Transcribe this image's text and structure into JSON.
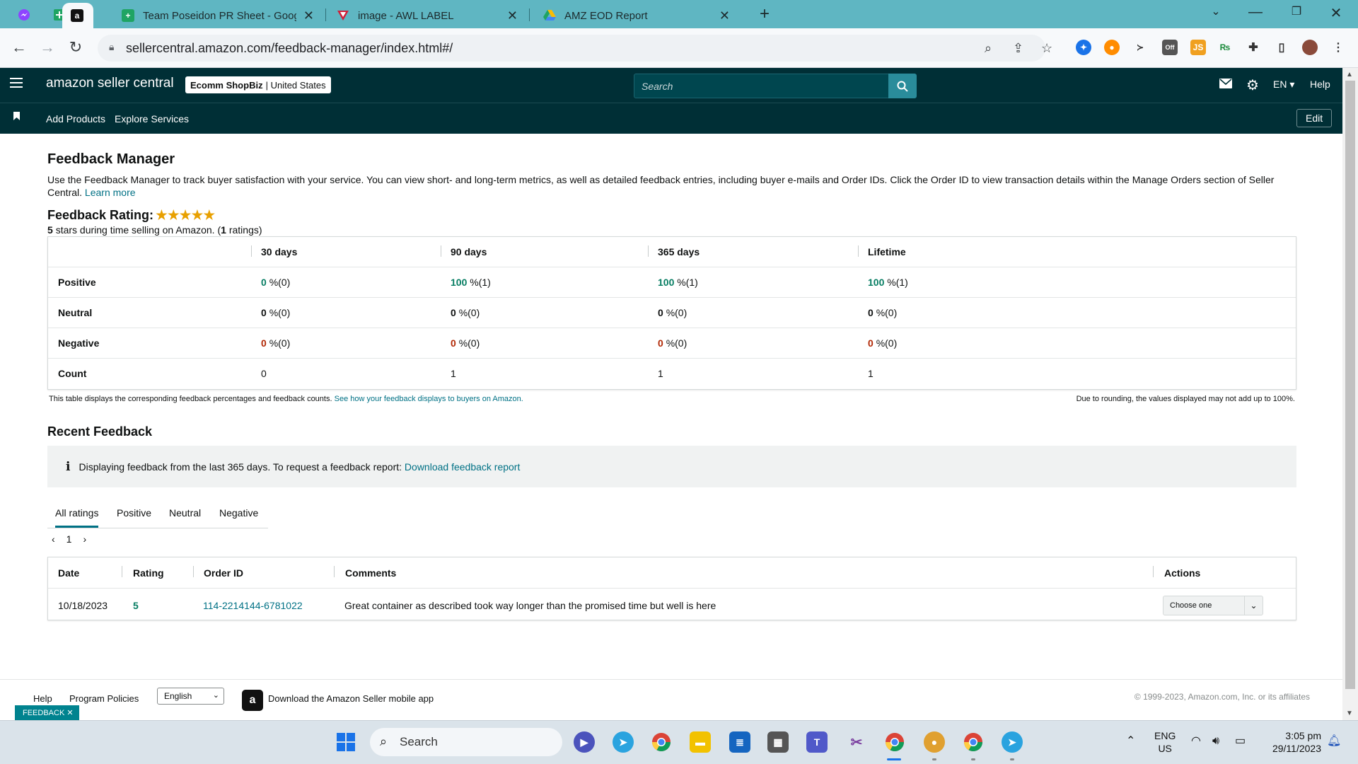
{
  "browser": {
    "tabs": [
      {
        "title": "Team Poseidon PR Sheet - Goog",
        "icon": "google-sheets-icon"
      },
      {
        "title": "image - AWL LABEL",
        "icon": "awl-label-icon"
      },
      {
        "title": "AMZ EOD Report",
        "icon": "drive-icon"
      }
    ],
    "url": "sellercentral.amazon.com/feedback-manager/index.html#/"
  },
  "header": {
    "logo": "amazon seller central",
    "store_name": "Ecomm ShopBiz",
    "store_region": "United States",
    "search_placeholder": "Search",
    "language": "EN",
    "help": "Help"
  },
  "subnav": {
    "links": [
      "Add Products",
      "Explore Services"
    ],
    "edit": "Edit"
  },
  "page": {
    "title": "Feedback Manager",
    "description": "Use the Feedback Manager to track buyer satisfaction with your service. You can view short- and long-term metrics, as well as detailed feedback entries, including buyer e-mails and Order IDs. Click the Order ID to view transaction details within the Manage Orders section of Seller Central.",
    "learn_more": "Learn more",
    "rating_title": "Feedback Rating:",
    "rating_stars": 5,
    "rating_value": "5",
    "rating_text_mid": "stars during time selling on Amazon. (",
    "rating_count": "1",
    "rating_text_end": "ratings)"
  },
  "metrics": {
    "columns": [
      "30 days",
      "90 days",
      "365 days",
      "Lifetime"
    ],
    "rows": [
      {
        "label": "Positive",
        "cells": [
          {
            "v": "0",
            "s": "%(0)"
          },
          {
            "v": "100",
            "s": "%(1)"
          },
          {
            "v": "100",
            "s": "%(1)"
          },
          {
            "v": "100",
            "s": "%(1)"
          }
        ]
      },
      {
        "label": "Neutral",
        "cells": [
          {
            "v": "0",
            "s": "%(0)"
          },
          {
            "v": "0",
            "s": "%(0)"
          },
          {
            "v": "0",
            "s": "%(0)"
          },
          {
            "v": "0",
            "s": "%(0)"
          }
        ]
      },
      {
        "label": "Negative",
        "cells": [
          {
            "v": "0",
            "s": "%(0)"
          },
          {
            "v": "0",
            "s": "%(0)"
          },
          {
            "v": "0",
            "s": "%(0)"
          },
          {
            "v": "0",
            "s": "%(0)"
          }
        ]
      },
      {
        "label": "Count",
        "cells": [
          {
            "v": "0"
          },
          {
            "v": "1"
          },
          {
            "v": "1"
          },
          {
            "v": "1"
          }
        ]
      }
    ],
    "note_left": "This table displays the corresponding feedback percentages and feedback counts.",
    "note_link": "See how your feedback displays to buyers on Amazon.",
    "note_right": "Due to rounding, the values displayed may not add up to 100%."
  },
  "recent": {
    "title": "Recent Feedback",
    "info_text": "Displaying feedback from the last 365 days. To request a feedback report:",
    "info_link": "Download feedback report",
    "filter_tabs": [
      "All ratings",
      "Positive",
      "Neutral",
      "Negative"
    ],
    "page_number": "1",
    "columns": [
      "Date",
      "Rating",
      "Order ID",
      "Comments",
      "Actions"
    ],
    "rows": [
      {
        "date": "10/18/2023",
        "rating": "5",
        "order_id": "114-2214144-6781022",
        "comment": "Great container as described took way longer than the promised time but well is here",
        "action": "Choose one"
      }
    ]
  },
  "footer": {
    "help": "Help",
    "policies": "Program Policies",
    "language": "English",
    "app_text": "Download the Amazon Seller mobile app",
    "copyright": "© 1999-2023, Amazon.com, Inc. or its affiliates",
    "feedback_tab": "FEEDBACK"
  },
  "taskbar": {
    "search": "Search",
    "lang_line1": "ENG",
    "lang_line2": "US",
    "time": "3:05 pm",
    "date": "29/11/2023"
  },
  "colors": {
    "seller_header": "#002f36",
    "link": "#007185",
    "positive": "#067d62",
    "negative": "#b12704",
    "star": "#e8a000",
    "tabbar": "#5fb6c2"
  }
}
